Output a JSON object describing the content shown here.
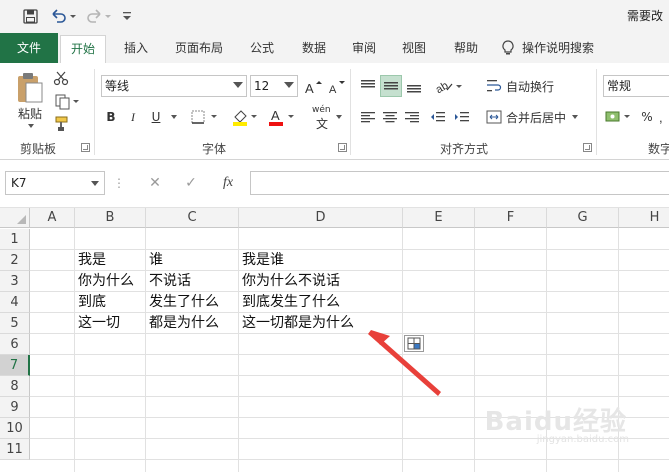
{
  "window": {
    "title_partial": "需要改"
  },
  "quick_access": {
    "icons": [
      "save-icon",
      "undo-icon",
      "redo-icon",
      "customize-qat-icon"
    ]
  },
  "ribbon_tabs": [
    {
      "label": "文件",
      "kind": "file"
    },
    {
      "label": "开始",
      "active": true
    },
    {
      "label": "插入"
    },
    {
      "label": "页面布局"
    },
    {
      "label": "公式"
    },
    {
      "label": "数据"
    },
    {
      "label": "审阅"
    },
    {
      "label": "视图"
    },
    {
      "label": "帮助"
    },
    {
      "label": "操作说明搜索",
      "icon": "lightbulb-icon"
    }
  ],
  "ribbon": {
    "clipboard": {
      "paste_label": "粘贴",
      "group_label": "剪贴板"
    },
    "font": {
      "font_name": "等线",
      "font_size": "12",
      "bold": "B",
      "italic": "I",
      "underline": "U",
      "fill_char": "A",
      "wen_char": "wén",
      "group_label": "字体"
    },
    "alignment": {
      "wrap_text": "自动换行",
      "merge_center": "合并后居中",
      "group_label": "对齐方式"
    },
    "number": {
      "format": "常规",
      "percent": "%",
      "group_label": "数字"
    }
  },
  "formula_bar": {
    "name_box": "K7",
    "cancel": "✕",
    "enter": "✓",
    "fx": "fx",
    "formula": ""
  },
  "sheet": {
    "columns": [
      "A",
      "B",
      "C",
      "D",
      "E",
      "F",
      "G",
      "H"
    ],
    "rows": [
      "1",
      "2",
      "3",
      "4",
      "5",
      "6",
      "7",
      "8",
      "9",
      "10",
      "11"
    ],
    "selected_row": "7",
    "cells": {
      "B2": "我是",
      "C2": "谁",
      "D2": "我是谁",
      "B3": "你为什么",
      "C3": "不说话",
      "D3": "你为什么不说话",
      "B4": "到底",
      "C4": "发生了什么",
      "D4": "到底发生了什么",
      "B5": "这一切",
      "C5": "都是为什么",
      "D5": "这一切都是为什么"
    }
  },
  "annotation": {
    "color": "#e8403a"
  },
  "watermark": {
    "text": "Baidu经验",
    "sub": "jingyan.baidu.com"
  },
  "colors": {
    "accent": "#217346",
    "annotation": "#e8403a"
  }
}
